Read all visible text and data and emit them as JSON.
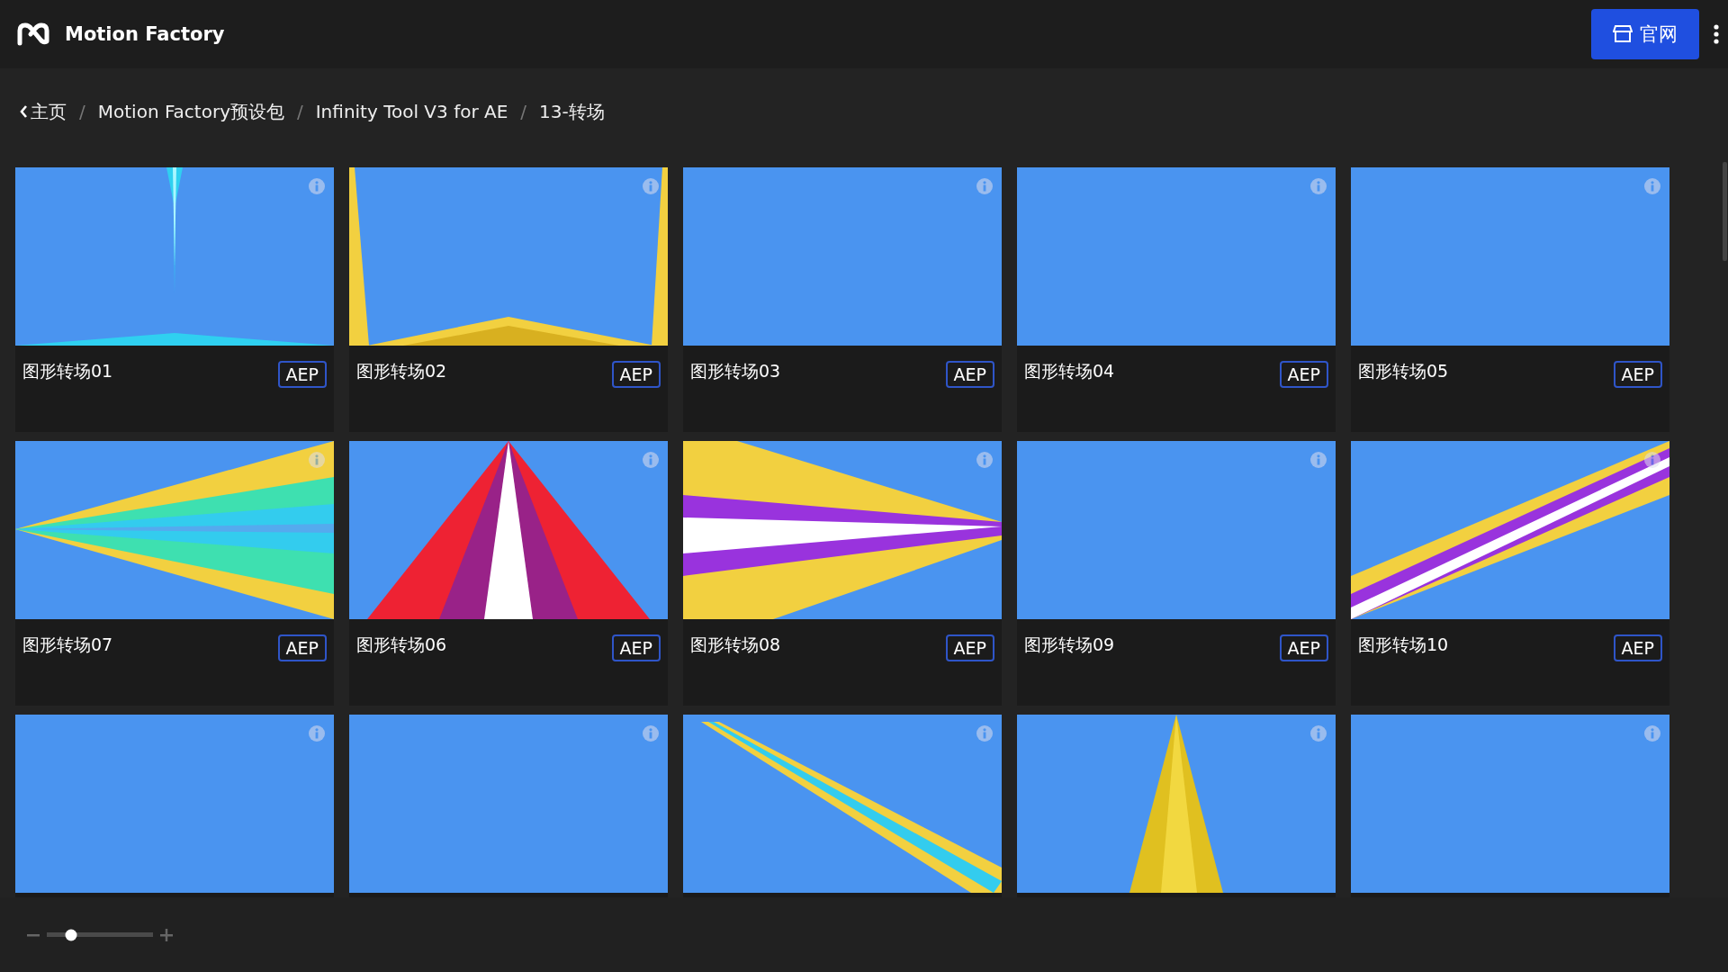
{
  "app": {
    "title": "Motion Factory"
  },
  "header": {
    "website_button": "官网"
  },
  "breadcrumb": [
    {
      "kind": "back",
      "label": "主页"
    },
    {
      "kind": "separator",
      "label": "/"
    },
    {
      "kind": "link",
      "label": "Motion Factory预设包"
    },
    {
      "kind": "separator",
      "label": "/"
    },
    {
      "kind": "link",
      "label": "Infinity Tool V3 for AE"
    },
    {
      "kind": "separator",
      "label": "/"
    },
    {
      "kind": "current",
      "label": "13-转场"
    }
  ],
  "cards": [
    {
      "title": "图形转场01",
      "badge": "AEP",
      "thumbnail": {
        "kind": "picture"
      }
    },
    {
      "title": "图形转场02",
      "badge": "AEP",
      "thumbnail": {
        "kind": "picture"
      }
    },
    {
      "title": "图形转场03",
      "badge": "AEP",
      "thumbnail": {
        "kind": "picture"
      }
    },
    {
      "title": "图形转场04",
      "badge": "AEP",
      "thumbnail": {
        "kind": "picture"
      }
    },
    {
      "title": "图形转场05",
      "badge": "AEP",
      "thumbnail": {
        "kind": "picture"
      }
    },
    {
      "title": "图形转场07",
      "badge": "AEP",
      "thumbnail": {
        "kind": "picture"
      }
    },
    {
      "title": "图形转场06",
      "badge": "AEP",
      "thumbnail": {
        "kind": "picture"
      }
    },
    {
      "title": "图形转场08",
      "badge": "AEP",
      "thumbnail": {
        "kind": "picture"
      }
    },
    {
      "title": "图形转场09",
      "badge": "AEP",
      "thumbnail": {
        "kind": "picture"
      }
    },
    {
      "title": "图形转场10",
      "badge": "AEP",
      "thumbnail": {
        "kind": "picture"
      }
    },
    {
      "thumbnail": {
        "kind": "picture"
      }
    },
    {
      "thumbnail": {
        "kind": "picture"
      }
    },
    {
      "thumbnail": {
        "kind": "picture"
      }
    },
    {
      "thumbnail": {
        "kind": "picture"
      }
    },
    {
      "thumbnail": {
        "kind": "picture"
      }
    }
  ],
  "zoom_slider": {
    "level": 0.23
  }
}
